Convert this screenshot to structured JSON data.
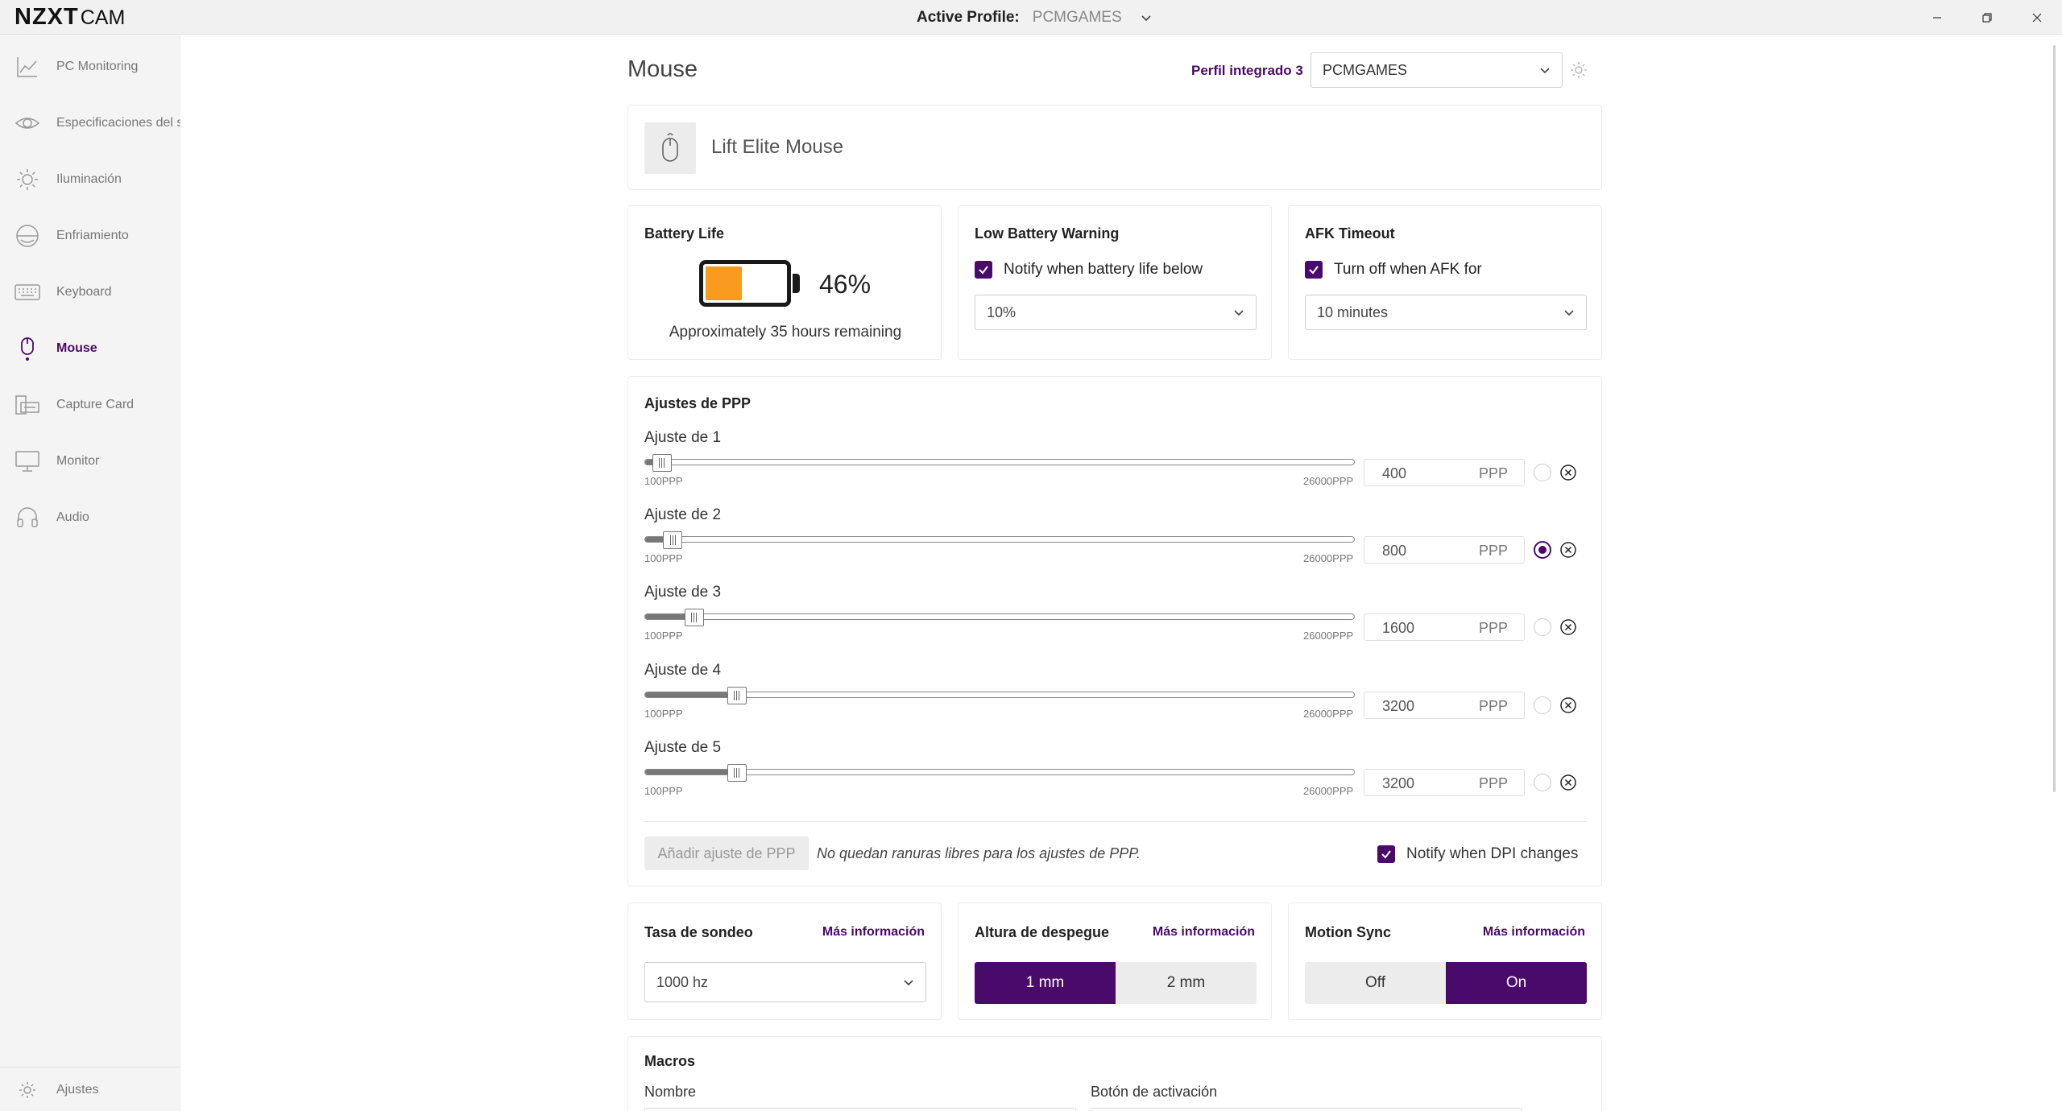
{
  "titlebar": {
    "logo_bold": "NZXT",
    "logo_light": "CAM",
    "active_profile_label": "Active Profile:",
    "active_profile_value": "PCMGAMES"
  },
  "sidebar": {
    "items": [
      {
        "label": "PC Monitoring",
        "icon": "chart-line-icon",
        "active": false
      },
      {
        "label": "Especificaciones del sistema",
        "icon": "eye-icon",
        "active": false
      },
      {
        "label": "Iluminación",
        "icon": "sun-icon",
        "active": false
      },
      {
        "label": "Enfriamiento",
        "icon": "cooling-icon",
        "active": false
      },
      {
        "label": "Keyboard",
        "icon": "keyboard-icon",
        "active": false
      },
      {
        "label": "Mouse",
        "icon": "mouse-icon",
        "active": true
      },
      {
        "label": "Capture Card",
        "icon": "capture-card-icon",
        "active": false
      },
      {
        "label": "Monitor",
        "icon": "monitor-icon",
        "active": false
      },
      {
        "label": "Audio",
        "icon": "headset-icon",
        "active": false
      }
    ],
    "settings_label": "Ajustes",
    "accent_color": "#4a0a6b"
  },
  "header": {
    "title": "Mouse",
    "onboard_profile_label": "Perfil integrado 3",
    "profile_select_value": "PCMGAMES"
  },
  "device": {
    "name": "Lift Elite Mouse"
  },
  "battery": {
    "title": "Battery Life",
    "percent_value": 46,
    "percent_label": "46%",
    "remaining": "Approximately 35 hours remaining",
    "fill_color": "#f79a1e"
  },
  "low_battery": {
    "title": "Low Battery Warning",
    "checkbox_label": "Notify when battery life below",
    "checked": true,
    "select_value": "10%"
  },
  "afk": {
    "title": "AFK Timeout",
    "checkbox_label": "Turn off when AFK for",
    "checked": true,
    "select_value": "10 minutes"
  },
  "dpi": {
    "title": "Ajustes de PPP",
    "min_label": "100PPP",
    "max_label": "26000PPP",
    "min": 100,
    "max": 26000,
    "unit": "PPP",
    "stages": [
      {
        "label": "Ajuste de 1",
        "value": 400,
        "value_text": "400",
        "selected": false
      },
      {
        "label": "Ajuste de 2",
        "value": 800,
        "value_text": "800",
        "selected": true
      },
      {
        "label": "Ajuste de 3",
        "value": 1600,
        "value_text": "1600",
        "selected": false
      },
      {
        "label": "Ajuste de 4",
        "value": 3200,
        "value_text": "3200",
        "selected": false
      },
      {
        "label": "Ajuste de 5",
        "value": 3200,
        "value_text": "3200",
        "selected": false
      }
    ],
    "add_button": "Añadir ajuste de PPP",
    "no_slots": "No quedan ranuras libres para los ajustes de PPP.",
    "notify_label": "Notify when DPI changes",
    "notify_checked": true
  },
  "polling": {
    "title": "Tasa de sondeo",
    "more": "Más información",
    "select_value": "1000 hz"
  },
  "lift_off": {
    "title": "Altura de despegue",
    "more": "Más información",
    "options": [
      "1 mm",
      "2 mm"
    ],
    "selected": 0
  },
  "motion_sync": {
    "title": "Motion Sync",
    "more": "Más información",
    "options": [
      "Off",
      "On"
    ],
    "selected": 1
  },
  "macros": {
    "title": "Macros",
    "col_name": "Nombre",
    "col_trigger": "Botón de activación"
  }
}
